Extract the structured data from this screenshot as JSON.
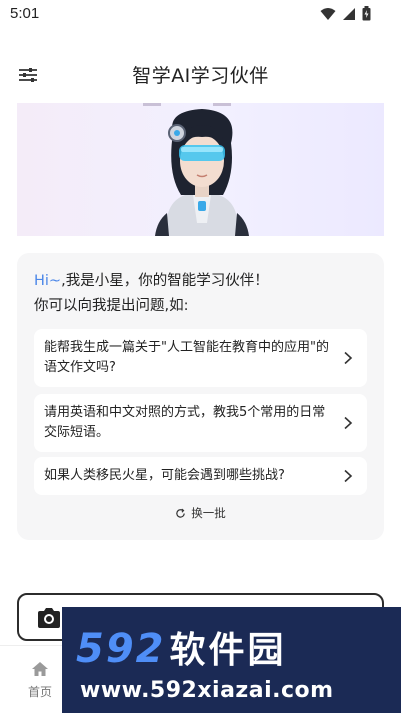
{
  "status_bar": {
    "time": "5:01"
  },
  "header": {
    "title": "智学AI学习伙伴"
  },
  "welcome": {
    "greeting_hi": "Hi~",
    "greeting_rest": ",我是小星，你的智能学习伙伴！",
    "sub": "你可以向我提出问题,如:"
  },
  "suggestions": [
    {
      "text": "能帮我生成一篇关于\"人工智能在教育中的应用\"的语文作文吗?"
    },
    {
      "text": "请用英语和中文对照的方式，教我5个常用的日常交际短语。"
    },
    {
      "text": "如果人类移民火星，可能会遇到哪些挑战?"
    }
  ],
  "refresh_label": "换一批",
  "bottom_nav": {
    "home_label": "首页"
  },
  "watermark": {
    "line1_num": "592",
    "line1_cn": "软件园",
    "line2": "www.592xiazai.com"
  },
  "colors": {
    "accent": "#4a86e8",
    "card_bg": "#f6f6f7",
    "watermark_bg": "#1b2a55",
    "watermark_num": "#4f8ef7"
  }
}
